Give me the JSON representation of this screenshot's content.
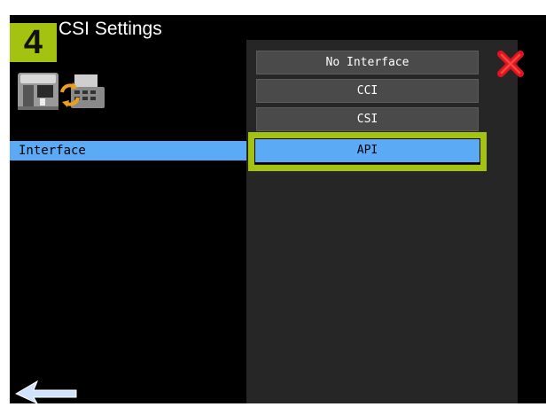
{
  "header": {
    "step_number": "4",
    "title": "CSI Settings"
  },
  "settings": {
    "interface_label": "Interface"
  },
  "menu": {
    "options": [
      "No Interface",
      "CCI",
      "CSI",
      "API"
    ],
    "selected": "API"
  },
  "colors": {
    "accent_green": "#a4c210",
    "selection_blue": "#5aaaf6",
    "close_red": "#e0141c"
  },
  "icons": {
    "device": "coffee-machine-and-register-icon",
    "close": "close-icon",
    "back": "back-arrow-icon"
  }
}
